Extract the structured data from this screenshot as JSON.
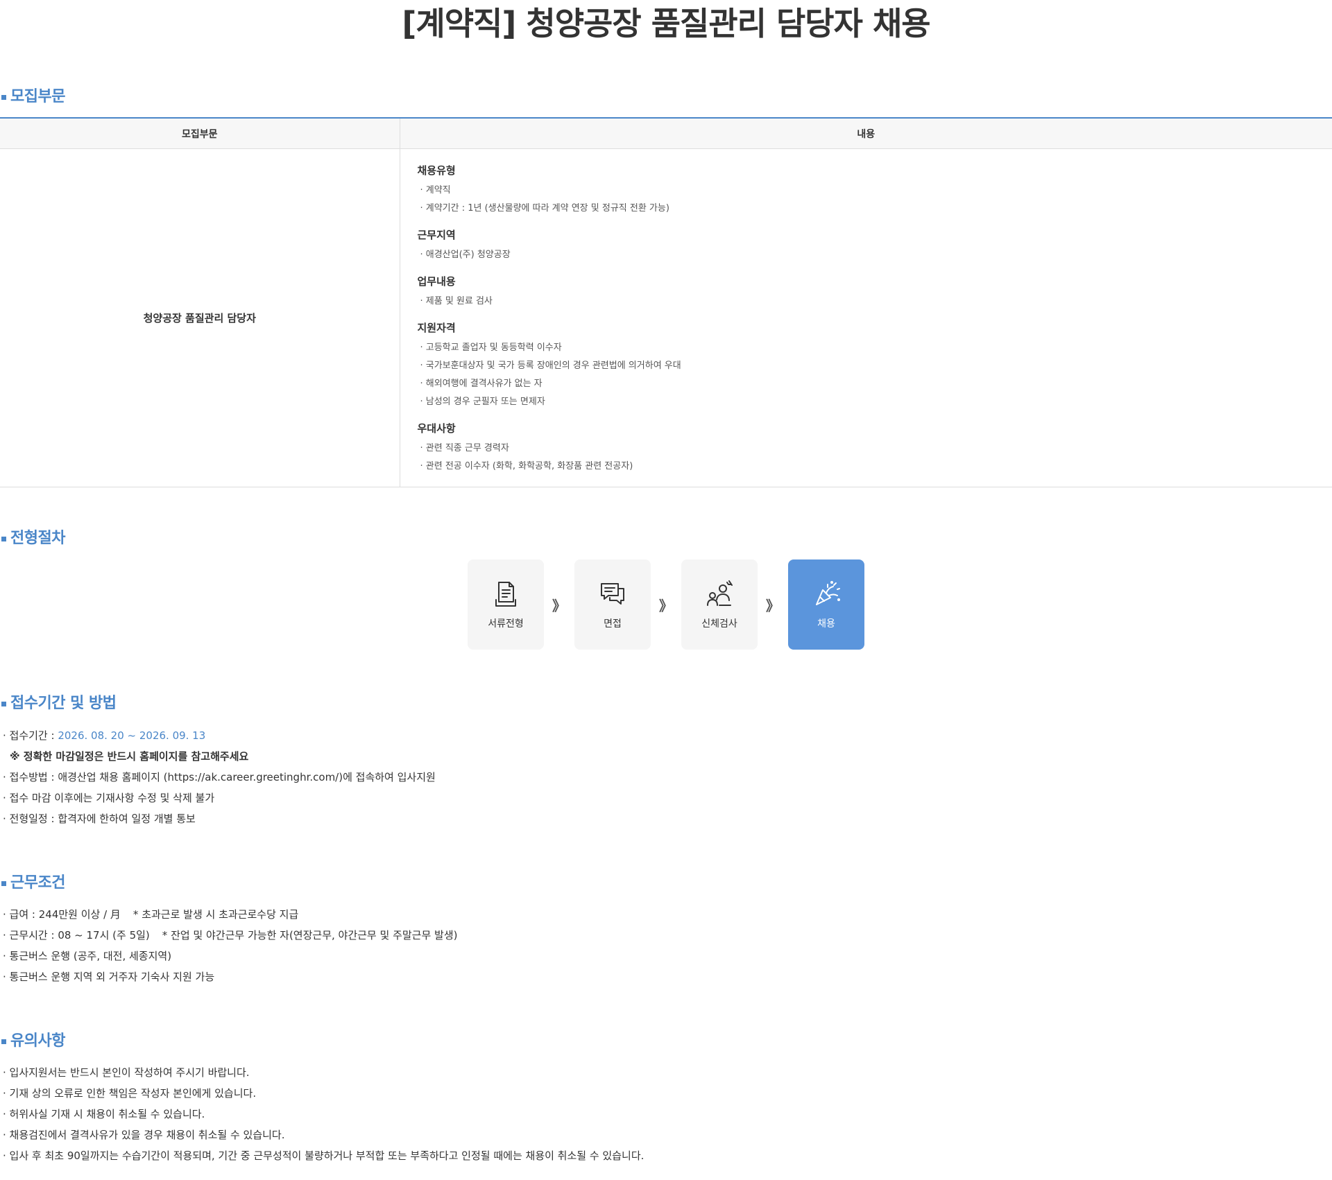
{
  "title": "[계약직] 청양공장 품질관리 담당자 채용",
  "recruit": {
    "heading": "모집부문",
    "col_role": "모집부문",
    "col_content": "내용",
    "role": "청양공장 품질관리 담당자",
    "groups": [
      {
        "label": "채용유형",
        "items": [
          "· 계약직",
          "· 계약기간 : 1년 (생산물량에 따라 계약 연장 및 정규직 전환 가능)"
        ]
      },
      {
        "label": "근무지역",
        "items": [
          "· 애경산업(주) 청양공장"
        ]
      },
      {
        "label": "업무내용",
        "items": [
          "· 제품 및 원료 검사"
        ]
      },
      {
        "label": "지원자격",
        "items": [
          "· 고등학교 졸업자 및 동등학력 이수자",
          "· 국가보훈대상자 및 국가 등록 장애인의 경우 관련법에 의거하여 우대",
          "· 해외여행에 결격사유가 없는 자",
          "· 남성의 경우 군필자 또는 면제자"
        ]
      },
      {
        "label": "우대사항",
        "items": [
          "· 관련 직종 근무 경력자",
          "· 관련 전공 이수자 (화학, 화학공학, 화장품 관련 전공자)"
        ]
      }
    ]
  },
  "process": {
    "heading": "전형절차",
    "arrow": "》",
    "steps": [
      {
        "label": "서류전형",
        "icon": "document-icon"
      },
      {
        "label": "면접",
        "icon": "chat-icon"
      },
      {
        "label": "신체검사",
        "icon": "health-check-icon"
      },
      {
        "label": "채용",
        "icon": "celebration-icon"
      }
    ],
    "active_color": "#5b95dc"
  },
  "apply": {
    "heading": "접수기간 및 방법",
    "period_label": "· 접수기간 : ",
    "period_value": "2026. 08. 20 ~ 2026. 09. 13",
    "notice": "※ 정확한 마감일정은 반드시 홈페이지를 참고해주세요",
    "method": "· 접수방법 : 애경산업 채용 홈페이지 (https://ak.career.greetinghr.com/)에 접속하여 입사지원",
    "edit_note": "· 접수 마감 이후에는 기재사항 수정 및 삭제 불가",
    "schedule": "· 전형일정 : 합격자에 한하여 일정 개별 통보"
  },
  "conditions": {
    "heading": "근무조건",
    "salary": "· 급여 : 244만원 이상 / 月",
    "salary_note": "* 초과근로 발생 시 초과근로수당 지급",
    "hours": "· 근무시간 : 08 ~ 17시 (주 5일)",
    "hours_note": "* 잔업 및 야간근무 가능한 자(연장근무, 야간근무 및 주말근무 발생)",
    "bus": "· 통근버스 운행 (공주, 대전, 세종지역)",
    "dorm": "· 통근버스 운행 지역 외 거주자 기숙사 지원 가능"
  },
  "cautions": {
    "heading": "유의사항",
    "items": [
      "· 입사지원서는 반드시 본인이 작성하여 주시기 바랍니다.",
      "· 기재 상의 오류로 인한 책임은 작성자 본인에게 있습니다.",
      "· 허위사실 기재 시 채용이 취소될 수 있습니다.",
      "· 채용검진에서 결격사유가 있을 경우 채용이 취소될 수 있습니다.",
      "· 입사 후 최초 90일까지는 수습기간이 적용되며, 기간 중 근무성적이 불량하거나 부적합 또는 부족하다고 인정될 때에는 채용이 취소될 수 있습니다."
    ]
  },
  "colors": {
    "accent": "#4a86c8",
    "text": "#333333"
  }
}
